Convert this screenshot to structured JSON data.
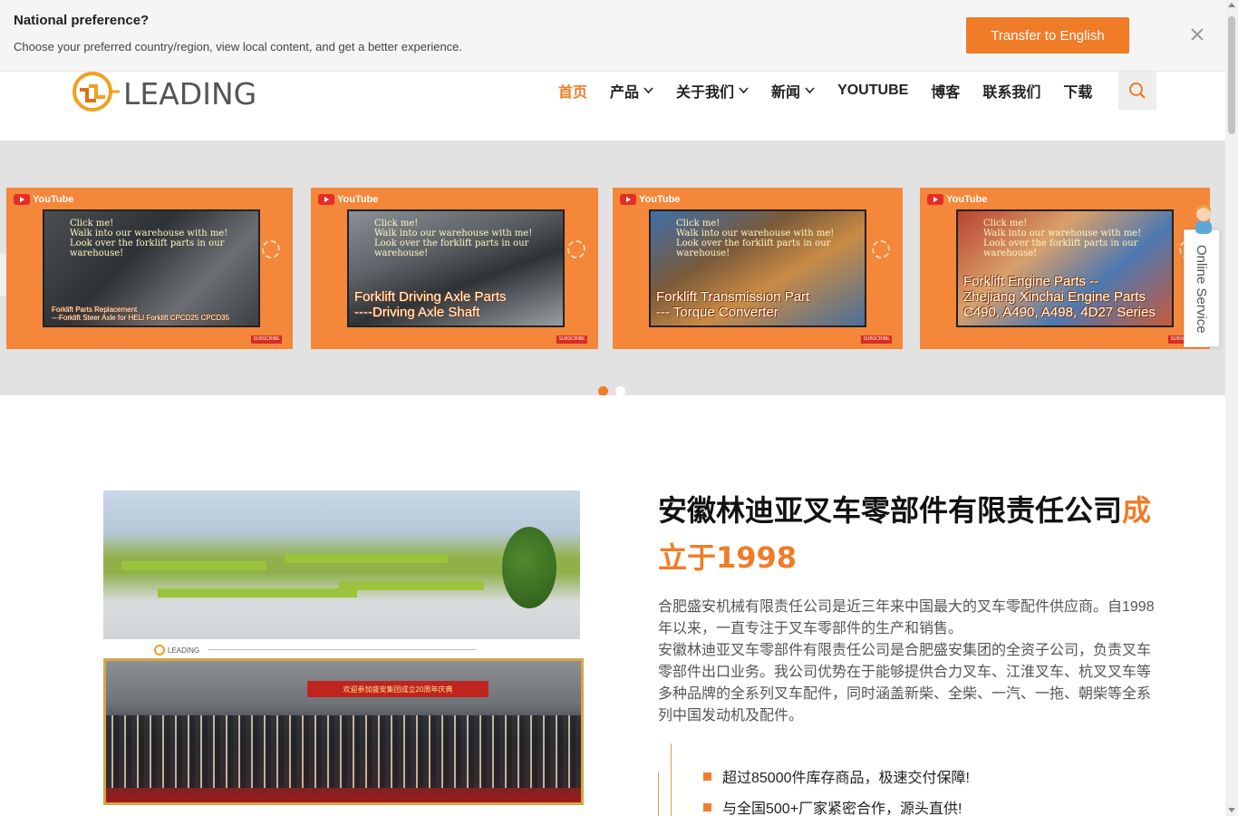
{
  "preference": {
    "title": "National preference?",
    "description": "Choose your preferred country/region, view local content, and get a better experience.",
    "button_label": "Transfer to English"
  },
  "logo": {
    "text": "LEADING"
  },
  "nav": {
    "items": [
      {
        "label": "首页",
        "active": true,
        "dropdown": false
      },
      {
        "label": "产品",
        "active": false,
        "dropdown": true
      },
      {
        "label": "关于我们",
        "active": false,
        "dropdown": true
      },
      {
        "label": "新闻",
        "active": false,
        "dropdown": true
      },
      {
        "label": "YOUTUBE",
        "active": false,
        "dropdown": false
      },
      {
        "label": "博客",
        "active": false,
        "dropdown": false
      },
      {
        "label": "联系我们",
        "active": false,
        "dropdown": false
      },
      {
        "label": "下载",
        "active": false,
        "dropdown": false
      }
    ]
  },
  "slider": {
    "cards": [
      {
        "badge": "YouTube",
        "note": "Click me!\nWalk into our warehouse with me!\nLook over the forklift parts in our warehouse!",
        "caption": "Forklift Parts Replacement\n---Forklift Steer Axle for HELI Forklift CPCD25 CPCD35",
        "subscribe": "SUBSCRIBE"
      },
      {
        "badge": "YouTube",
        "note": "Click me!\nWalk into our warehouse with me!\nLook over the forklift parts in our warehouse!",
        "caption": "Forklift Driving Axle Parts\n----Driving Axle Shaft",
        "subscribe": "SUBSCRIBE"
      },
      {
        "badge": "YouTube",
        "note": "Click me!\nWalk into our warehouse with me!\nLook over the forklift parts in our warehouse!",
        "caption": "Forklift Transmission Part\n--- Torque Converter",
        "subscribe": "SUBSCRIBE"
      },
      {
        "badge": "YouTube",
        "note": "Click me!\nWalk into our warehouse with me!\nLook over the forklift parts in our warehouse!",
        "caption": "Forklift Engine Parts --\nZhejiang Xinchai Engine Parts\nC490, A490, A498, 4D27 Series",
        "subscribe": "SUBSCRIBE"
      }
    ],
    "active_dot": 0,
    "dot_count": 2
  },
  "online_service": {
    "label": "Online Service"
  },
  "about": {
    "title_main": "安徽林迪亚叉车零部件有限责任公司",
    "title_highlight": "成立于1998",
    "paragraph": "合肥盛安机械有限责任公司是近三年来中国最大的叉车零配件供应商。自1998年以来，一直专注于叉车零部件的生产和销售。\n安徽林迪亚叉车零部件有限责任公司是合肥盛安集团的全资子公司，负责叉车零部件出口业务。我公司优势在于能够提供合力叉车、江淮叉车、杭叉叉车等多种品牌的全系列叉车配件，同时涵盖新柴、全柴、一汽、一拖、朝柴等全系列中国发动机及配件。",
    "features": [
      "超过85000件库存商品，极速交付保障!",
      "与全国500+厂家紧密合作，源头直供!"
    ],
    "mini_logo": "LEADING",
    "group_banner": "欢迎参加盛安集团成立20周年庆典"
  },
  "colors": {
    "accent": "#f07c28",
    "banner_bg": "#f5f5f5"
  }
}
